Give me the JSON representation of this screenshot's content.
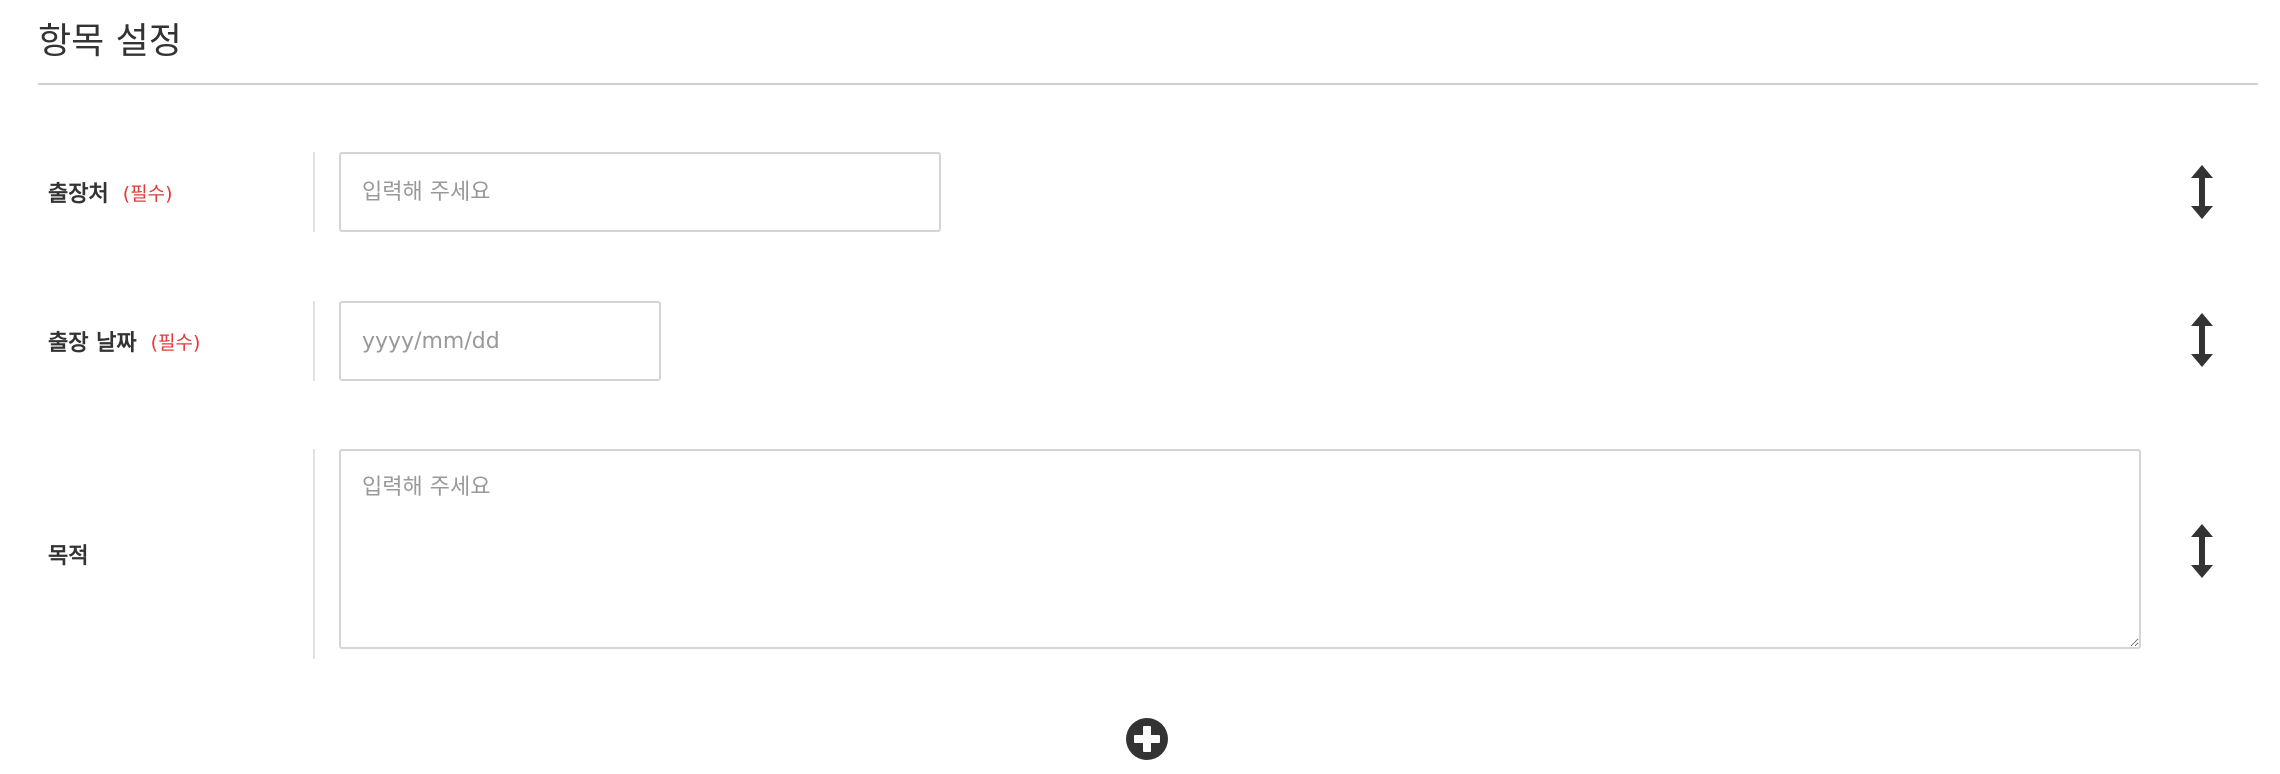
{
  "section": {
    "title": "항목 설정"
  },
  "fields": [
    {
      "label": "출장처",
      "required_label": "(필수)",
      "type": "text",
      "placeholder": "입력해 주세요",
      "value": ""
    },
    {
      "label": "출장 날짜",
      "required_label": "(필수)",
      "type": "date",
      "placeholder": "yyyy/mm/dd",
      "value": ""
    },
    {
      "label": "목적",
      "required_label": "",
      "type": "textarea",
      "placeholder": "입력해 주세요",
      "value": ""
    }
  ],
  "icons": {
    "reorder": "vertical-arrows-icon",
    "add": "plus-circle-icon",
    "resize": "textarea-resize-grip-icon"
  },
  "colors": {
    "text": "#333333",
    "required": "#e03a3a",
    "placeholder": "#999999",
    "border": "#d4d4d4",
    "divider": "#cfcfcf",
    "icon": "#333333"
  }
}
